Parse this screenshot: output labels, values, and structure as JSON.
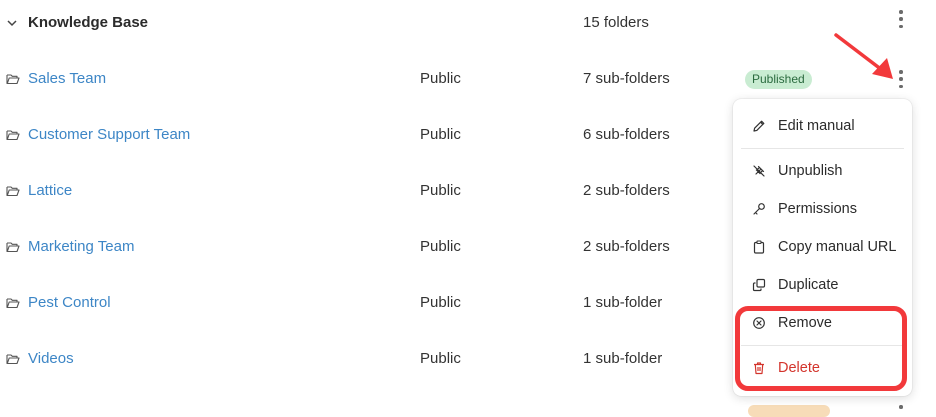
{
  "header": {
    "title": "Knowledge Base",
    "count": "15 folders"
  },
  "rows": [
    {
      "name": "Sales Team",
      "access": "Public",
      "count": "7 sub-folders",
      "status": "Published"
    },
    {
      "name": "Customer Support Team",
      "access": "Public",
      "count": "6 sub-folders",
      "status": ""
    },
    {
      "name": "Lattice",
      "access": "Public",
      "count": "2 sub-folders",
      "status": ""
    },
    {
      "name": "Marketing Team",
      "access": "Public",
      "count": "2 sub-folders",
      "status": ""
    },
    {
      "name": "Pest Control",
      "access": "Public",
      "count": "1 sub-folder",
      "status": ""
    },
    {
      "name": "Videos",
      "access": "Public",
      "count": "1 sub-folder",
      "status": ""
    }
  ],
  "menu": {
    "items": [
      {
        "label": "Edit manual",
        "icon": "pencil-icon"
      },
      {
        "label": "Unpublish",
        "icon": "unpublish-icon"
      },
      {
        "label": "Permissions",
        "icon": "key-icon"
      },
      {
        "label": "Copy manual URL",
        "icon": "clipboard-icon"
      },
      {
        "label": "Duplicate",
        "icon": "duplicate-icon"
      },
      {
        "label": "Remove",
        "icon": "circle-x-icon"
      },
      {
        "label": "Delete",
        "icon": "trash-icon"
      }
    ]
  },
  "colors": {
    "link": "#3d86c6",
    "published_bg": "#c9ecd2",
    "published_text": "#2a6a3e",
    "delete": "#d3342c",
    "annotation": "#f2393b"
  }
}
